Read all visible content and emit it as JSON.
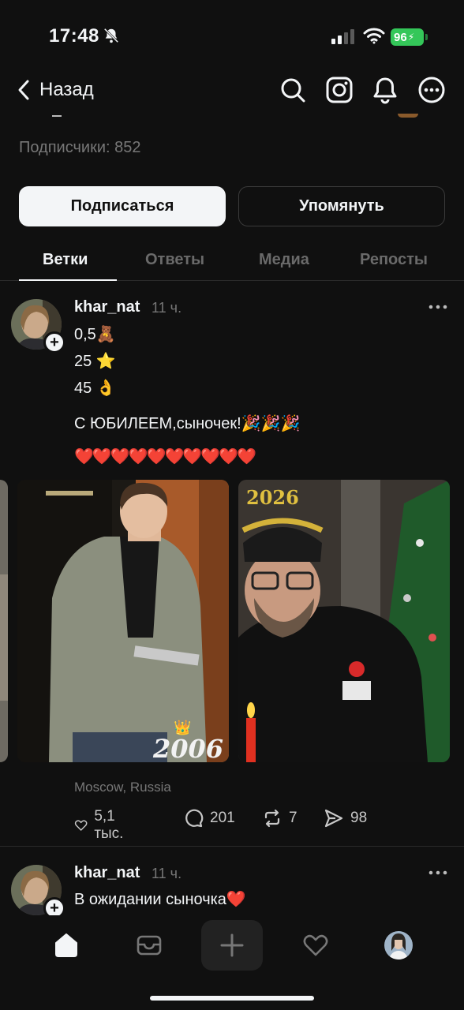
{
  "status_bar": {
    "time": "17:48",
    "battery": "96"
  },
  "header": {
    "back_label": "Назад"
  },
  "profile": {
    "followers_label": "Подписчики: 852"
  },
  "buttons": {
    "follow_label": "Подписаться",
    "mention_label": "Упомянуть"
  },
  "tabs": [
    {
      "label": "Ветки",
      "active": true
    },
    {
      "label": "Ответы",
      "active": false
    },
    {
      "label": "Медиа",
      "active": false
    },
    {
      "label": "Репосты",
      "active": false
    }
  ],
  "posts": [
    {
      "username": "khar_nat",
      "time": "11 ч.",
      "lines": [
        "0,5🧸",
        "25 ⭐",
        "45 👌",
        "С ЮБИЛЕЕМ,сыночек!🎉🎉🎉",
        "❤️❤️❤️❤️❤️❤️❤️❤️❤️❤️"
      ],
      "photo_captions": [
        "2006",
        "2026"
      ],
      "location": "Moscow, Russia",
      "likes": "5,1 тыс.",
      "comments": "201",
      "reposts": "7",
      "shares": "98"
    },
    {
      "username": "khar_nat",
      "time": "11 ч.",
      "lines": [
        "В ожидании сыночка❤️"
      ]
    }
  ],
  "colors": {
    "background": "#101010",
    "accent_battery": "#34c759",
    "heart": "#e0162b"
  }
}
